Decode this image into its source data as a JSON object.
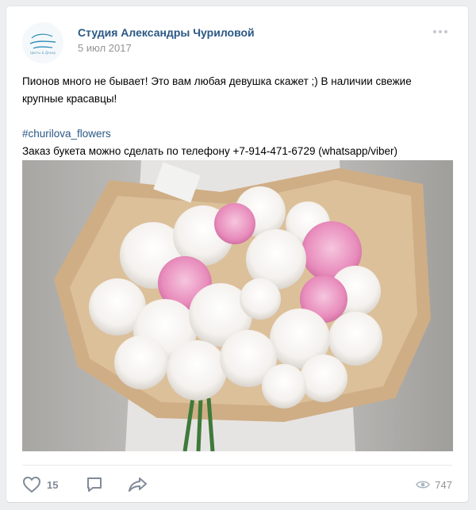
{
  "post": {
    "author": "Студия Александры Чуриловой",
    "date": "5 июл 2017",
    "avatar_icon": "studio-logo-icon",
    "avatar_text": [
      "Студия",
      "Александры",
      "Чуриловой",
      "Цветы & Декор"
    ],
    "text_line1": "Пионов много не бывает! Это вам любая девушка скажет ;) В наличии свежие",
    "text_line2": "крупные красавцы!",
    "hashtag": "#churilova_flowers",
    "text_line3": "Заказ букета можно сделать по телефону +7-914-471-6729 (whatsapp/viber)",
    "photo_subject": "peony-bouquet-photo"
  },
  "footer": {
    "likes": "15",
    "comment_icon": "comment-icon",
    "share_icon": "share-icon",
    "views": "747"
  },
  "colors": {
    "link": "#2a5885",
    "muted": "#939393",
    "icon": "#828a99",
    "background": "#edeef0"
  }
}
